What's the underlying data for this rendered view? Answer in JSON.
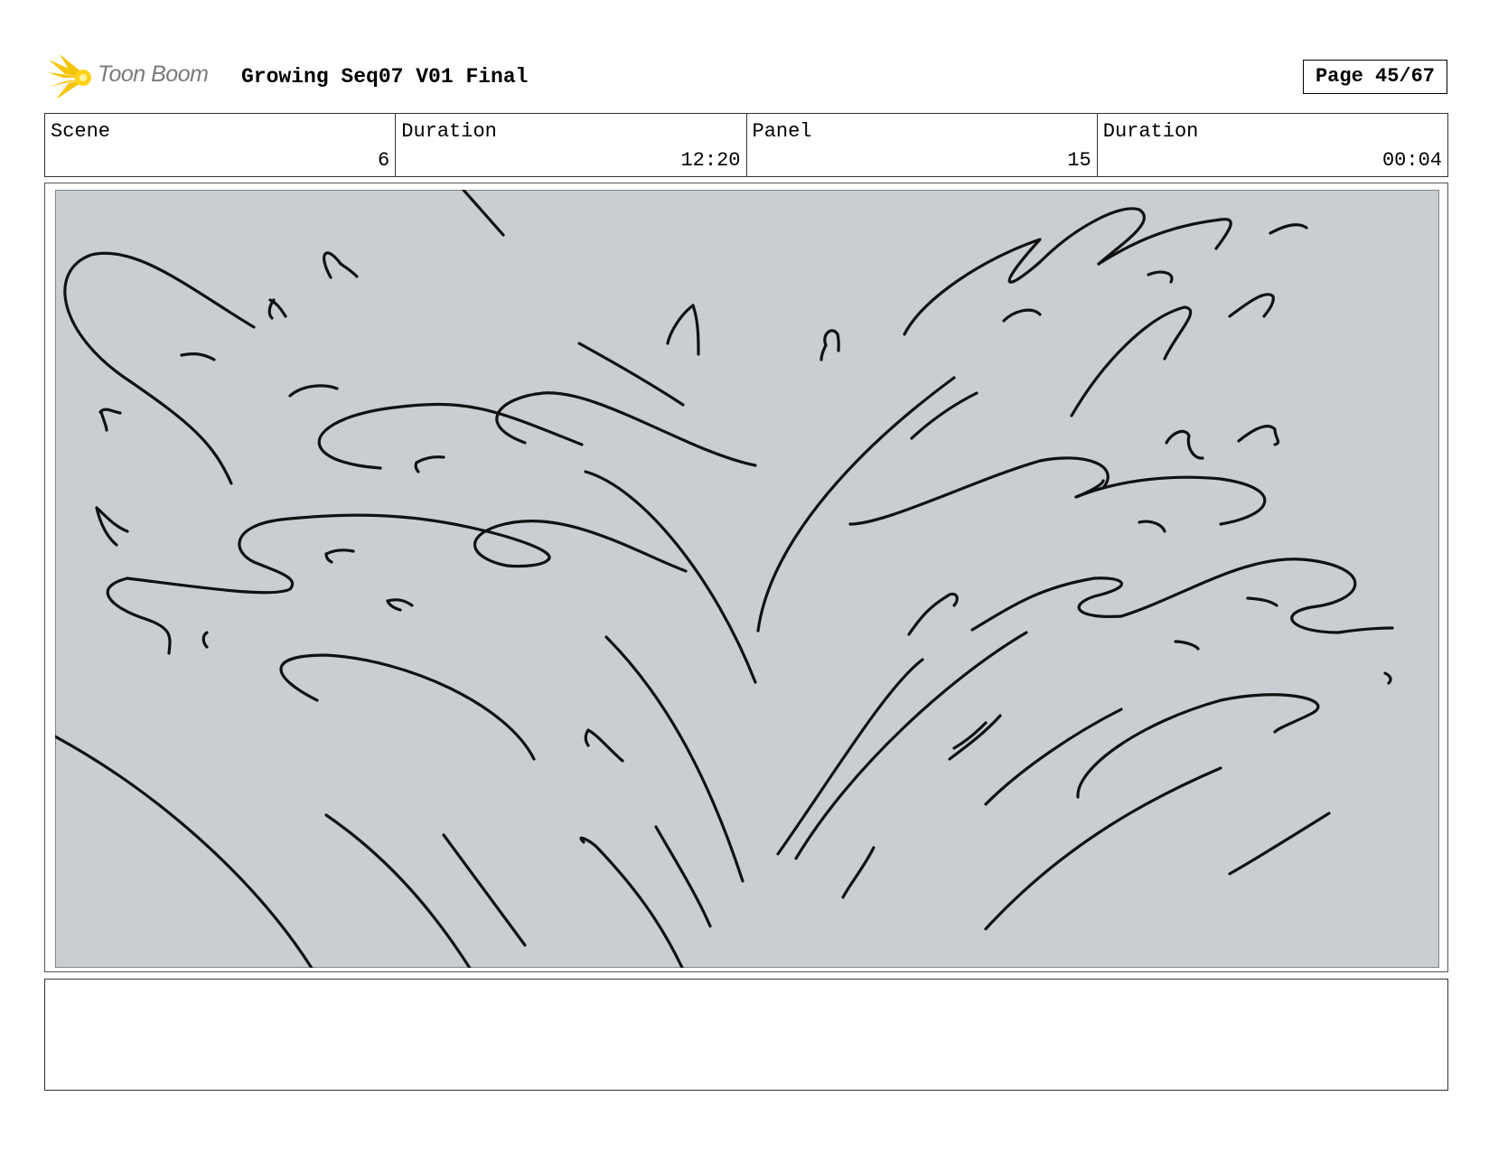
{
  "header": {
    "logo_text": "Toon Boom",
    "title": "Growing Seq07 V01 Final",
    "page": "Page 45/67"
  },
  "info": [
    {
      "label": "Scene",
      "value": "6"
    },
    {
      "label": "Duration",
      "value": "12:20"
    },
    {
      "label": "Panel",
      "value": "15"
    },
    {
      "label": "Duration",
      "value": "00:04"
    }
  ],
  "panel": {
    "background_color": "#c9ced3",
    "line_color": "#111111"
  },
  "notes": {
    "text": ""
  },
  "colors": {
    "logo_star": "#f5c400",
    "logo_text": "#7a7a7a"
  }
}
